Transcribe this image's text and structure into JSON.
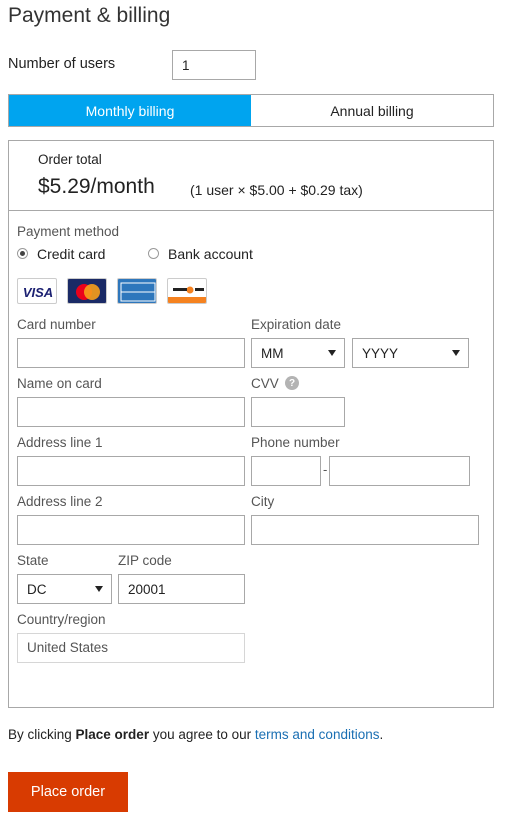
{
  "page": {
    "title": "Payment & billing"
  },
  "users": {
    "label": "Number of users",
    "value": "1"
  },
  "billing_tabs": [
    {
      "label": "Monthly billing",
      "active": true
    },
    {
      "label": "Annual billing",
      "active": false
    }
  ],
  "order": {
    "label": "Order total",
    "amount": "$5.29/month",
    "breakdown": "(1 user × $5.00 + $0.29 tax)"
  },
  "payment": {
    "label": "Payment method",
    "options": [
      {
        "label": "Credit card",
        "selected": true
      },
      {
        "label": "Bank account",
        "selected": false
      }
    ],
    "cards": [
      {
        "name": "VISA",
        "icon": "visa-icon"
      },
      {
        "name": "MasterCard",
        "icon": "mastercard-icon"
      },
      {
        "name": "AMERICAN EXPRESS",
        "icon": "amex-icon"
      },
      {
        "name": "DISCOVER",
        "icon": "discover-icon"
      }
    ]
  },
  "form": {
    "card_number_label": "Card number",
    "expiration_label": "Expiration date",
    "month_value": "MM",
    "year_value": "YYYY",
    "name_label": "Name on card",
    "cvv_label": "CVV",
    "cvv_help": "?",
    "address1_label": "Address line 1",
    "phone_label": "Phone number",
    "phone_separator": "-",
    "address2_label": "Address line 2",
    "city_label": "City",
    "state_label": "State",
    "state_value": "DC",
    "zip_label": "ZIP code",
    "zip_value": "20001",
    "country_label": "Country/region",
    "country_value": "United States"
  },
  "agreement": {
    "prefix": "By clicking ",
    "bold": "Place order",
    "middle": " you agree to our ",
    "link": "terms and conditions",
    "suffix": "."
  },
  "actions": {
    "place_order": "Place order"
  },
  "colors": {
    "accent": "#00a4ef",
    "primary_button": "#d83b01",
    "link": "#1a6fb3"
  }
}
